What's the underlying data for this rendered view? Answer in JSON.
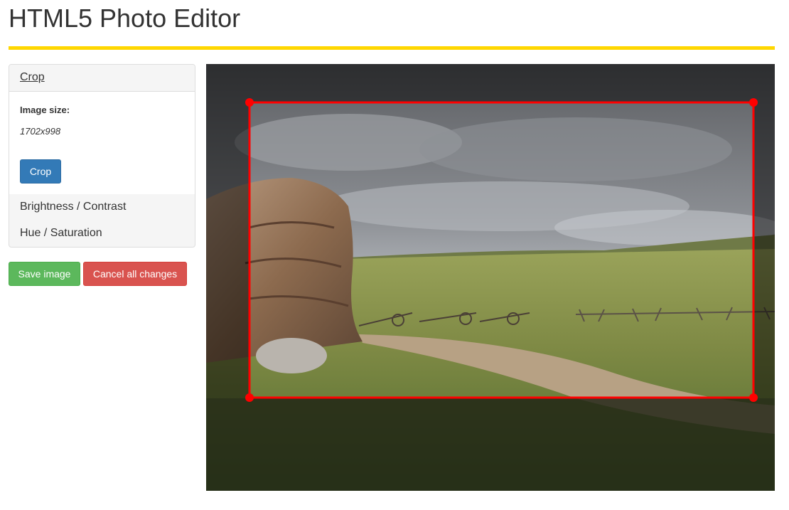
{
  "app": {
    "title": "HTML5 Photo Editor"
  },
  "sidebar": {
    "crop_link": "Crop",
    "image_size_label": "Image size:",
    "image_size_value": "1702x998",
    "crop_button": "Crop",
    "tools": [
      {
        "label": "Brightness / Contrast"
      },
      {
        "label": "Hue / Saturation"
      }
    ]
  },
  "actions": {
    "save_label": "Save image",
    "cancel_label": "Cancel all changes"
  },
  "colors": {
    "accent_rule": "#ffd700",
    "crop_frame": "#ff0000",
    "primary": "#337ab7",
    "success": "#5cb85c",
    "danger": "#d9534f"
  },
  "icons": {
    "crop_handles": "crop-handle-dot"
  }
}
